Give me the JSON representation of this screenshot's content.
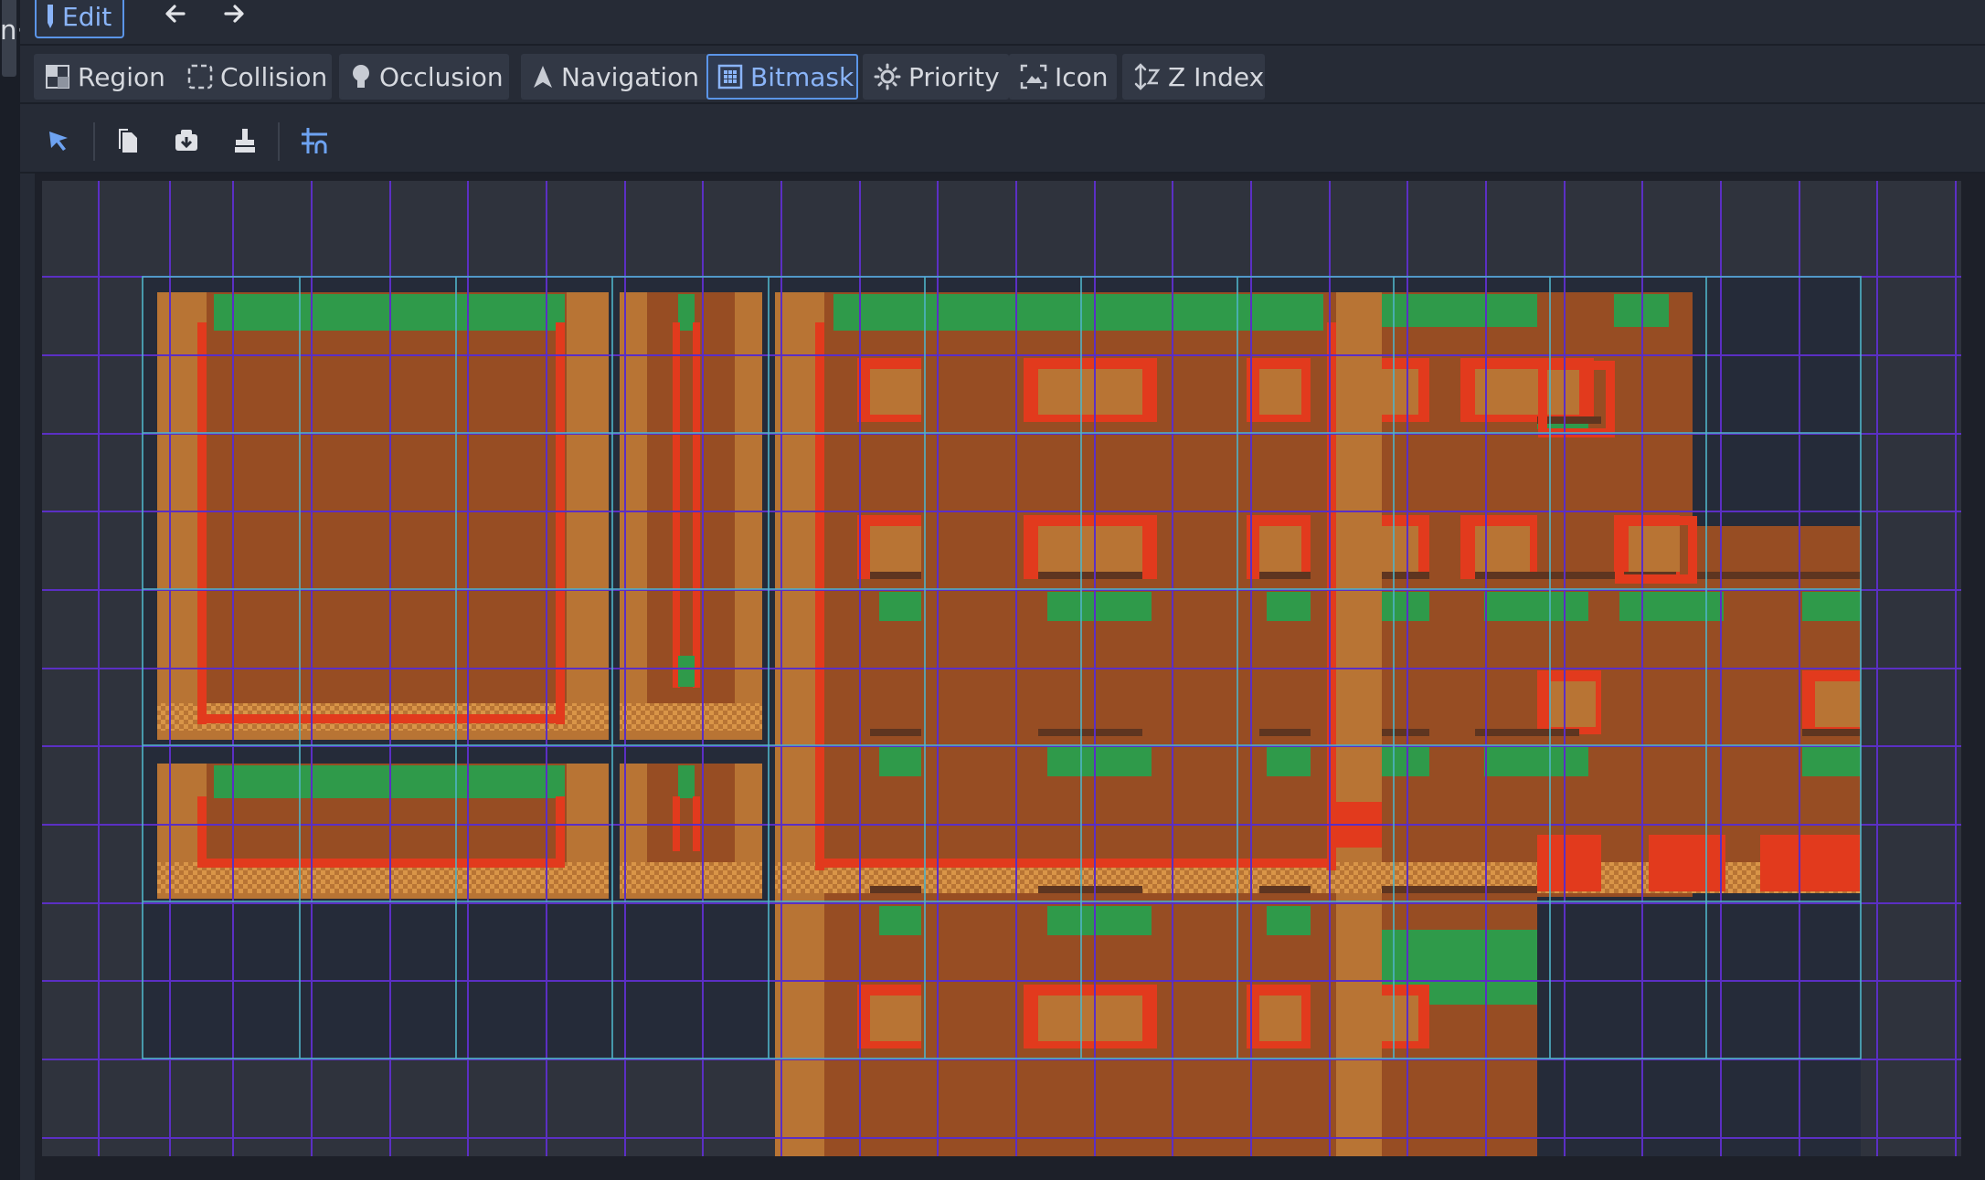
{
  "left_strip": {
    "text": "n·"
  },
  "header": {
    "edit_label": "Edit"
  },
  "tabs": [
    {
      "label": "Region",
      "icon": "region-icon",
      "active": false
    },
    {
      "label": "Collision",
      "icon": "collision-icon",
      "active": false
    },
    {
      "label": "Occlusion",
      "icon": "occlusion-icon",
      "active": false
    },
    {
      "label": "Navigation",
      "icon": "navigation-icon",
      "active": false
    },
    {
      "label": "Bitmask",
      "icon": "bitmask-icon",
      "active": true
    },
    {
      "label": "Priority",
      "icon": "priority-icon",
      "active": false
    },
    {
      "label": "Icon",
      "icon": "icon-mode-icon",
      "active": false
    },
    {
      "label": "Z Index",
      "icon": "z-index-icon",
      "active": false
    }
  ],
  "toolbar": {
    "tools": [
      "select-icon",
      "copy-icon",
      "paste-icon",
      "clear-icon",
      "grid-snap-icon"
    ]
  },
  "colors": {
    "accent": "#5b95e8",
    "canvas_bg": "#2f333d",
    "tile_empty": "#252b39",
    "tile_brown": "#974d23",
    "tile_light": "#b87434",
    "tile_dark": "#5e3520",
    "bitmask_red": "#e23a1d",
    "bitmask_green": "#2f9a4a",
    "grid_cyan": "#4fb3c8",
    "grid_purple": "#5b2fc4"
  }
}
